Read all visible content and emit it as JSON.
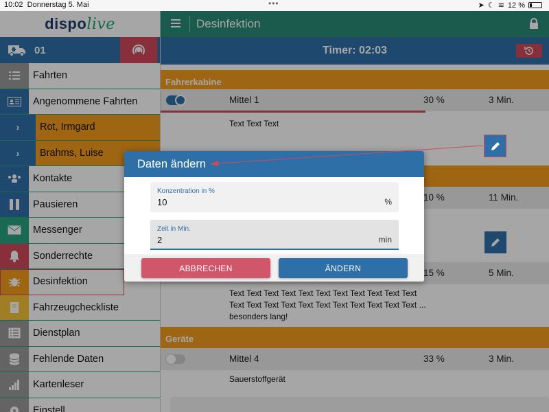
{
  "status_bar": {
    "time": "10:02",
    "date": "Donnerstag 5. Mai",
    "battery": "12 %"
  },
  "sidebar": {
    "logo_main": "dispo",
    "logo_accent": "live",
    "vehicle_id": "01",
    "items": [
      {
        "label": "Fahrten",
        "icon": "checklist-icon"
      },
      {
        "label": "Angenommene Fahrten",
        "icon": "id-card-icon"
      },
      {
        "label": "Rot, Irmgard",
        "icon": "chevron-right-icon"
      },
      {
        "label": "Brahms, Luise",
        "icon": "chevron-right-icon"
      },
      {
        "label": "Kontakte",
        "icon": "contacts-icon"
      },
      {
        "label": "Pausieren",
        "icon": "pause-icon"
      },
      {
        "label": "Messenger",
        "icon": "mail-icon"
      },
      {
        "label": "Sonderrechte",
        "icon": "bell-icon"
      },
      {
        "label": "Desinfektion",
        "icon": "bug-icon"
      },
      {
        "label": "Fahrzeugcheckliste",
        "icon": "book-icon"
      },
      {
        "label": "Dienstplan",
        "icon": "list-icon"
      },
      {
        "label": "Fehlende Daten",
        "icon": "database-icon"
      },
      {
        "label": "Kartenleser",
        "icon": "signal-icon"
      },
      {
        "label": "Einstell",
        "icon": "gear-icon"
      }
    ]
  },
  "header": {
    "title": "Desinfektion"
  },
  "timer": {
    "label": "Timer: 02:03"
  },
  "sections": {
    "s1_title": "Fahrerkabine",
    "s3_title": "Geräte"
  },
  "rows": {
    "r1": {
      "name": "Mittel 1",
      "pct": "30 %",
      "mins": "3 Min.",
      "note": "Text Text Text",
      "enabled": true
    },
    "r2": {
      "pct": "10 %",
      "mins": "11 Min."
    },
    "r3": {
      "pct": "15 %",
      "mins": "5 Min.",
      "note": "Text Text Text Text Text Text Text Text Text Text Text Text Text Text Text Text Text Text Text Text Text Text ... besonders lang!"
    },
    "r4": {
      "name": "Mittel 4",
      "pct": "33 %",
      "mins": "3 Min.",
      "note": "Sauerstoffgerät",
      "enabled": false
    }
  },
  "dialog": {
    "title": "Daten ändern",
    "field1": {
      "label": "Konzentration in %",
      "value": "10",
      "unit": "%"
    },
    "field2": {
      "label": "Zeit in Min.",
      "value": "2",
      "unit": "min"
    },
    "cancel_label": "ABBRECHEN",
    "ok_label": "ÄNDERN"
  },
  "colors": {
    "primary": "#2f6fa8",
    "accent": "#2a8c78",
    "warning": "#f39c1e",
    "danger": "#d0495a"
  }
}
